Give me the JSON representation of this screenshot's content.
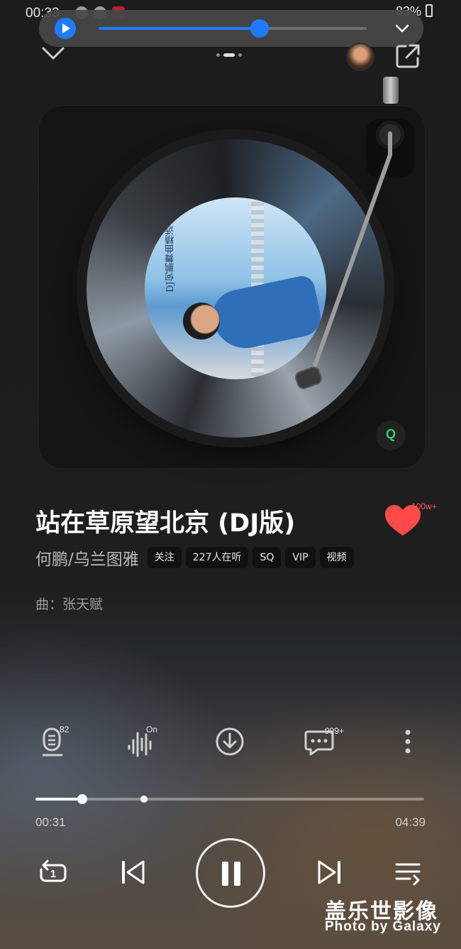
{
  "status_bar": {
    "time": "00:33",
    "battery": "83%"
  },
  "mini_player": {
    "progress": 0.6
  },
  "song": {
    "title": "站在草原望北京 (DJ版)",
    "artist": "何鹏/乌兰图雅",
    "tags": [
      "关注",
      "227人在听",
      "SQ",
      "VIP",
      "视频"
    ],
    "composer": "曲：张天赋",
    "likes": "100w+",
    "album_text": "DJ何鹏舞曲精选"
  },
  "actions": {
    "lyrics_badge": "82",
    "effect_badge": "On",
    "comments_badge": "999+"
  },
  "playback": {
    "current_time": "00:31",
    "total_time": "04:39",
    "played_fraction": 0.12,
    "buffered_fraction": 0.28,
    "repeat_mode_number": "1"
  },
  "watermark": {
    "cn": "盖乐世影像",
    "en": "Photo by Galaxy"
  },
  "colors": {
    "accent": "#1e7bff",
    "like": "#ff4a4a",
    "qq_green": "#2ecf67"
  }
}
